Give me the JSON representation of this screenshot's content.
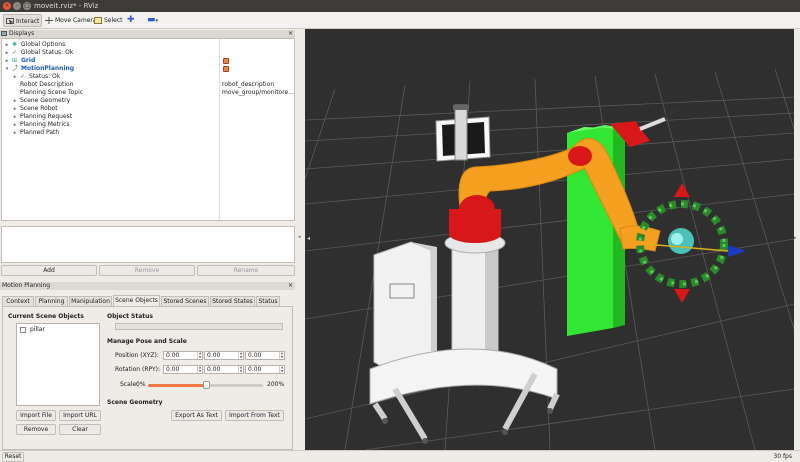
{
  "window": {
    "title": "moveit.rviz* - RViz"
  },
  "toolbar": {
    "interact": "Interact",
    "move_camera": "Move Camera",
    "select": "Select"
  },
  "displays": {
    "title": "Displays",
    "items": [
      {
        "label": "Global Options"
      },
      {
        "label": "Global Status: Ok"
      },
      {
        "label": "Grid"
      },
      {
        "label": "MotionPlanning"
      },
      {
        "label": "Status: Ok"
      },
      {
        "label": "Robot Description",
        "value": "robot_description"
      },
      {
        "label": "Planning Scene Topic",
        "value": "move_group/monitore..."
      },
      {
        "label": "Scene Geometry"
      },
      {
        "label": "Scene Robot"
      },
      {
        "label": "Planning Request"
      },
      {
        "label": "Planning Metrics"
      },
      {
        "label": "Planned Path"
      }
    ],
    "buttons": {
      "add": "Add",
      "remove": "Remove",
      "rename": "Rename"
    }
  },
  "motion_planning": {
    "title": "Motion Planning",
    "tabs": [
      "Context",
      "Planning",
      "Manipulation",
      "Scene Objects",
      "Stored Scenes",
      "Stored States",
      "Status"
    ],
    "active_tab": "Scene Objects",
    "current_scene_objects": "Current Scene Objects",
    "objects": [
      "pillar"
    ],
    "object_status": "Object Status",
    "manage_pose": "Manage Pose and Scale",
    "position_label": "Position (XYZ):",
    "rotation_label": "Rotation (RPY):",
    "position": [
      "0.00",
      "0.00",
      "0.00"
    ],
    "rotation": [
      "0.00",
      "0.00",
      "0.00"
    ],
    "scale_label": "Scale:",
    "scale_min": "0%",
    "scale_max": "200%",
    "scale_value": 0.5,
    "import_file": "Import File",
    "import_url": "Import URL",
    "remove": "Remove",
    "clear": "Clear",
    "scene_geometry": "Scene Geometry",
    "export_text": "Export As Text",
    "import_text": "Import From Text"
  },
  "status_bar": {
    "reset": "Reset",
    "fps": "30 fps"
  },
  "colors": {
    "accent": "#f07746",
    "grid_green": "#2a8a2a",
    "pillar": "#33e633",
    "arm_orange": "#f5a020",
    "arm_red": "#d81818"
  }
}
